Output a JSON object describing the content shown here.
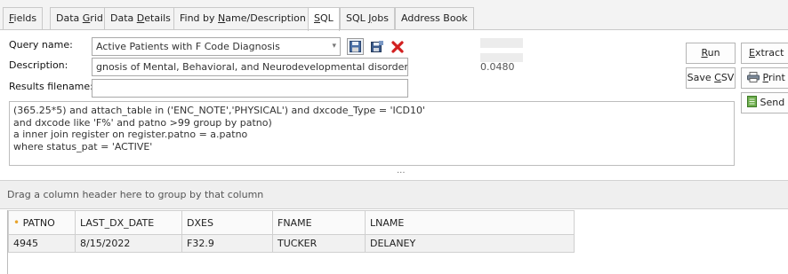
{
  "tabs": [
    {
      "pre": "",
      "u": "F",
      "post": "ields"
    },
    {
      "pre": "Data ",
      "u": "G",
      "post": "rid"
    },
    {
      "pre": "Data ",
      "u": "D",
      "post": "etails"
    },
    {
      "pre": "Find by ",
      "u": "N",
      "post": "ame/Description"
    },
    {
      "pre": "",
      "u": "S",
      "post": "QL"
    },
    {
      "pre": "SQL ",
      "u": "J",
      "post": "obs"
    },
    {
      "pre": "Address Book",
      "u": "",
      "post": ""
    }
  ],
  "active_tab": "SQL",
  "form": {
    "query_name_label": "Query name:",
    "query_name_value": "Active Patients with F Code Diagnosis",
    "description_label": "Description:",
    "description_value": "gnosis of Mental, Behavioral, and Neurodevelopmental disorders.",
    "results_filename_label": "Results filename:",
    "results_filename_value": ""
  },
  "timing_value": "0.0480",
  "buttons": {
    "run": {
      "pre": "",
      "u": "R",
      "post": "un"
    },
    "extract": {
      "pre": "",
      "u": "E",
      "post": "xtract"
    },
    "save_csv": {
      "pre": "Save ",
      "u": "C",
      "post": "SV"
    },
    "print": {
      "pre": "",
      "u": "P",
      "post": "rint"
    },
    "send": "Send"
  },
  "sql_lines": [
    "(365.25*5) and attach_table in ('ENC_NOTE','PHYSICAL') and dxcode_Type = 'ICD10'",
    "and dxcode like 'F%' and patno >99 group by patno)",
    "a  inner join register on register.patno = a.patno",
    "where status_pat = 'ACTIVE'"
  ],
  "splitter_dots": "...",
  "group_panel_text": "Drag a column header here to group by that column",
  "grid": {
    "columns": [
      "PATNO",
      "LAST_DX_DATE",
      "DXES",
      "FNAME",
      "LNAME"
    ],
    "rows": [
      [
        "4945",
        "8/15/2022",
        "F32.9",
        "TUCKER",
        "DELANEY"
      ]
    ]
  },
  "colors": {
    "accent_star": "#e8a42c",
    "delete_x": "#d22020"
  },
  "icons": [
    "save-icon",
    "save-as-icon",
    "delete-icon",
    "printer-icon",
    "send-icon",
    "combo-arrow-icon"
  ]
}
